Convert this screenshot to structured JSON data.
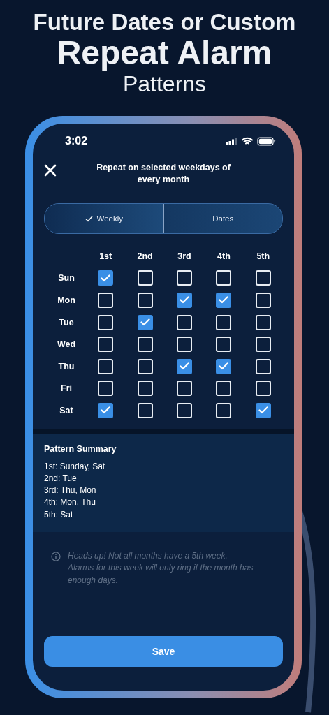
{
  "headline": [
    "Future Dates or Custom",
    "Repeat Alarm",
    "Patterns"
  ],
  "status_bar": {
    "time": "3:02"
  },
  "title": "Repeat on selected weekdays of every month",
  "segments": [
    {
      "label": "Weekly",
      "selected": true
    },
    {
      "label": "Dates",
      "selected": false
    }
  ],
  "grid": {
    "columns": [
      "1st",
      "2nd",
      "3rd",
      "4th",
      "5th"
    ],
    "rows": [
      {
        "day": "Sun",
        "cells": [
          {
            "checked": true
          },
          {
            "checked": false
          },
          {
            "checked": false
          },
          {
            "checked": false
          },
          {
            "checked": false
          }
        ]
      },
      {
        "day": "Mon",
        "cells": [
          {
            "checked": false
          },
          {
            "checked": false
          },
          {
            "checked": true
          },
          {
            "checked": true
          },
          {
            "checked": false
          }
        ]
      },
      {
        "day": "Tue",
        "cells": [
          {
            "checked": false
          },
          {
            "checked": true
          },
          {
            "checked": false
          },
          {
            "checked": false
          },
          {
            "checked": false
          }
        ]
      },
      {
        "day": "Wed",
        "cells": [
          {
            "checked": false
          },
          {
            "checked": false
          },
          {
            "checked": false
          },
          {
            "checked": false
          },
          {
            "checked": false
          }
        ]
      },
      {
        "day": "Thu",
        "cells": [
          {
            "checked": false
          },
          {
            "checked": false
          },
          {
            "checked": true
          },
          {
            "checked": true
          },
          {
            "checked": false
          }
        ]
      },
      {
        "day": "Fri",
        "cells": [
          {
            "checked": false
          },
          {
            "checked": false
          },
          {
            "checked": false
          },
          {
            "checked": false
          },
          {
            "checked": false
          }
        ]
      },
      {
        "day": "Sat",
        "cells": [
          {
            "checked": true
          },
          {
            "checked": false
          },
          {
            "checked": false
          },
          {
            "checked": false
          },
          {
            "checked": true
          }
        ]
      }
    ]
  },
  "summary": {
    "title": "Pattern Summary",
    "lines": [
      "1st: Sunday, Sat",
      "2nd: Tue",
      "3rd: Thu, Mon",
      "4th: Mon, Thu",
      "5th: Sat"
    ]
  },
  "note": "Heads up! Not all months have a 5th week. Alarms for this week will only ring if the month has enough days.",
  "save_button": "Save"
}
